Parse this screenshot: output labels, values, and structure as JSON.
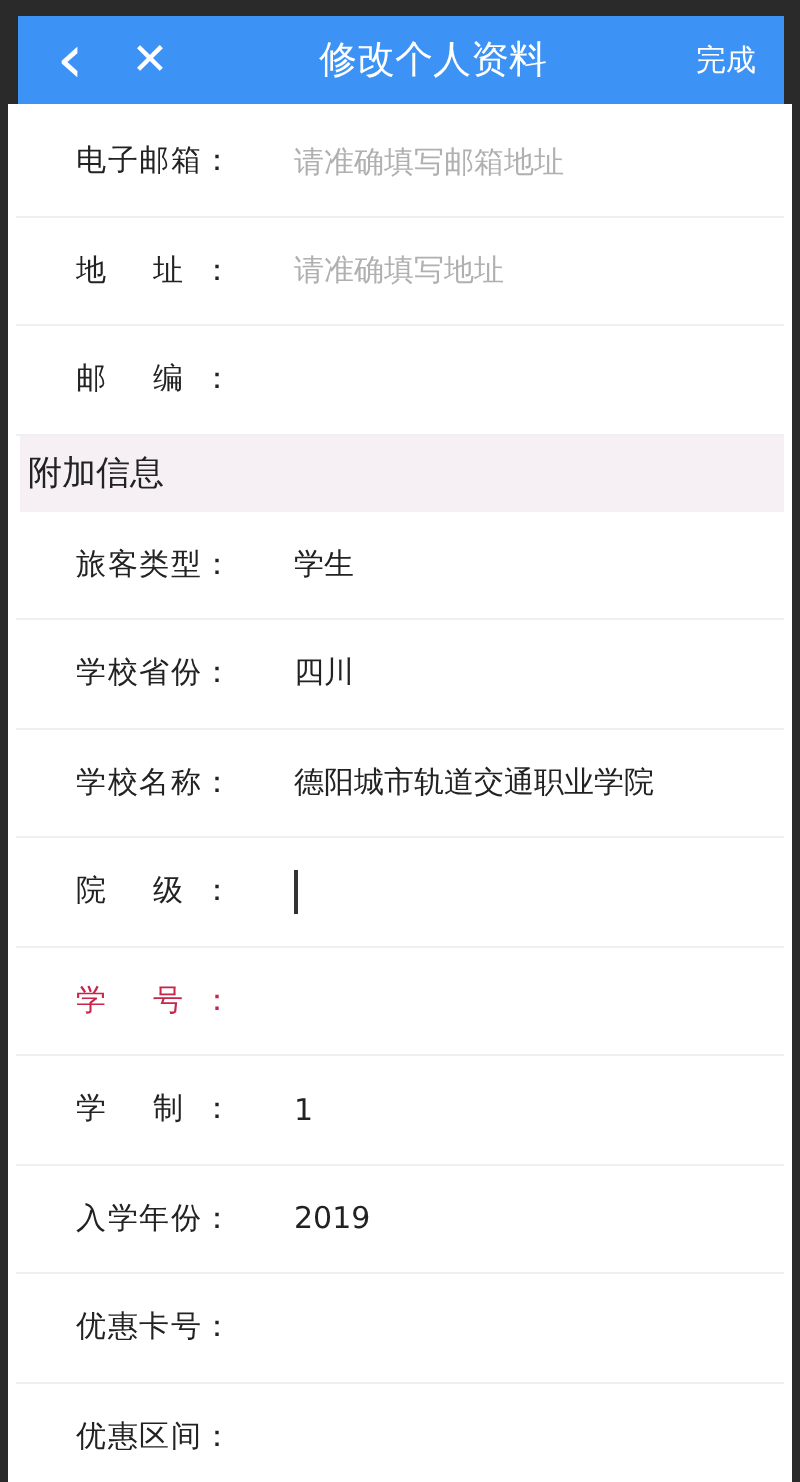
{
  "header": {
    "back": "‹",
    "close": "✕",
    "title": "修改个人资料",
    "done": "完成"
  },
  "contact_rows": [
    {
      "label": "电子邮箱：",
      "placeholder": "请准确填写邮箱地址",
      "focused": false,
      "required": false
    },
    {
      "label": "地 址：",
      "placeholder": "请准确填写地址",
      "focused": false,
      "required": false
    },
    {
      "label": "邮 编：",
      "focused": false,
      "required": false
    }
  ],
  "section": {
    "title": "附加信息"
  },
  "extra_rows": [
    {
      "label": "旅客类型：",
      "value": "学生",
      "focused": false,
      "required": false
    },
    {
      "label": "学校省份：",
      "value": "四川",
      "focused": false,
      "required": false
    },
    {
      "label": "学校名称：",
      "value": "德阳城市轨道交通职业学院",
      "focused": false,
      "required": false
    },
    {
      "label": "院 级：",
      "focused": true,
      "required": false
    },
    {
      "label": "学 号：",
      "focused": false,
      "required": true
    },
    {
      "label": "学 制：",
      "value": "1",
      "focused": false,
      "required": false
    },
    {
      "label": "入学年份：",
      "value": "2019",
      "focused": false,
      "required": false
    },
    {
      "label": "优惠卡号：",
      "focused": false,
      "required": false
    },
    {
      "label": "优惠区间：",
      "focused": false,
      "required": false
    }
  ]
}
